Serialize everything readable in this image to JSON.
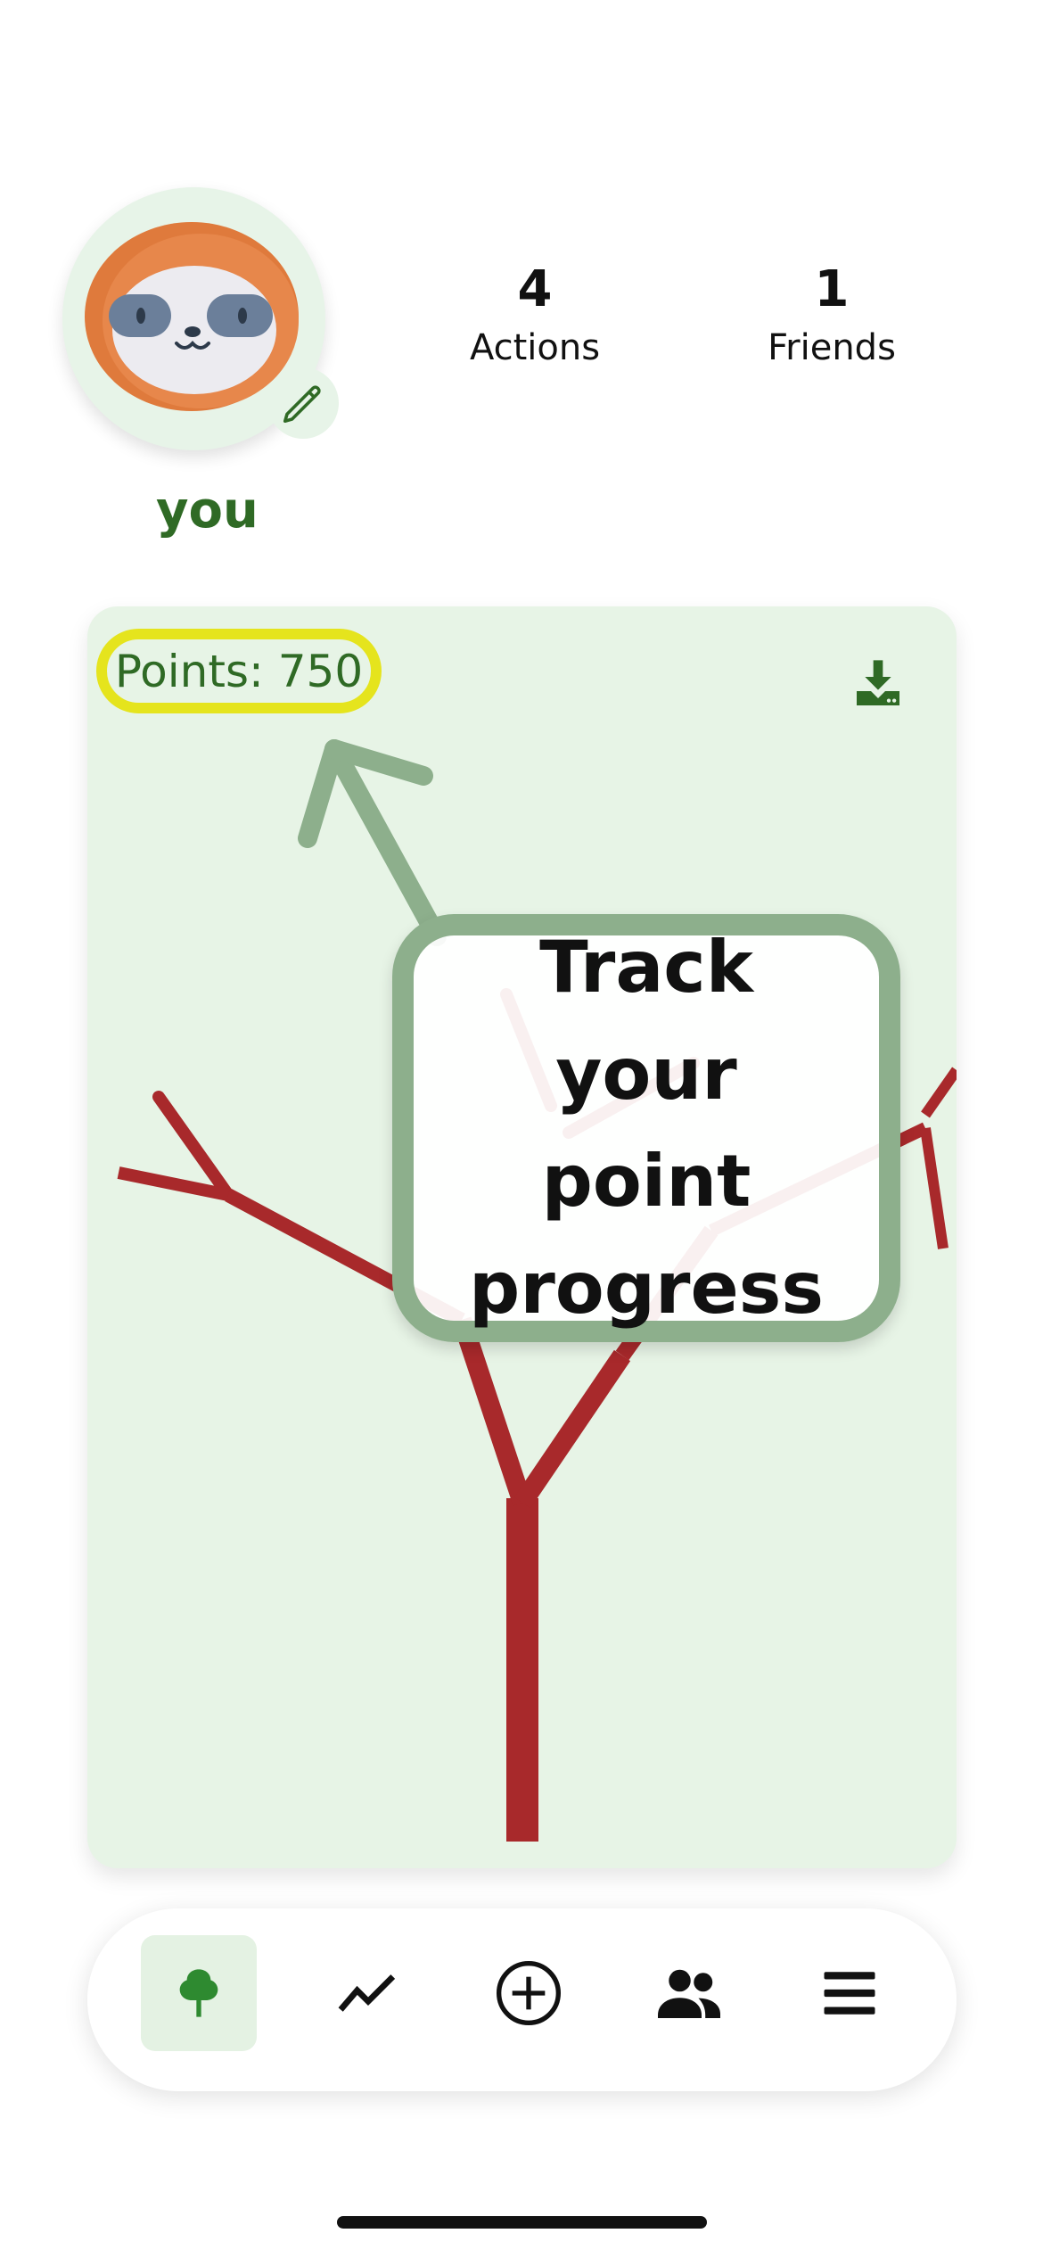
{
  "profile": {
    "username": "you",
    "avatar_icon": "sloth-avatar-icon",
    "edit_icon": "pencil-icon"
  },
  "stats": {
    "actions": {
      "value": "4",
      "label": "Actions"
    },
    "friends": {
      "value": "1",
      "label": "Friends"
    }
  },
  "tree_card": {
    "points_label": "Points: 750",
    "download_icon": "download-icon"
  },
  "tooltip": {
    "text": "Track your point progress"
  },
  "nav": {
    "items": [
      {
        "name": "tree",
        "icon": "tree-icon",
        "active": true
      },
      {
        "name": "stats",
        "icon": "trend-line-icon",
        "active": false
      },
      {
        "name": "add",
        "icon": "plus-circle-icon",
        "active": false
      },
      {
        "name": "friends",
        "icon": "people-icon",
        "active": false
      },
      {
        "name": "menu",
        "icon": "hamburger-menu-icon",
        "active": false
      }
    ]
  },
  "colors": {
    "brand_green": "#2f6a25",
    "card_bg": "#e7f4e6",
    "tree_red": "#a8292b",
    "highlight_yellow": "#e5e41d",
    "tooltip_border": "#8daf8c"
  }
}
